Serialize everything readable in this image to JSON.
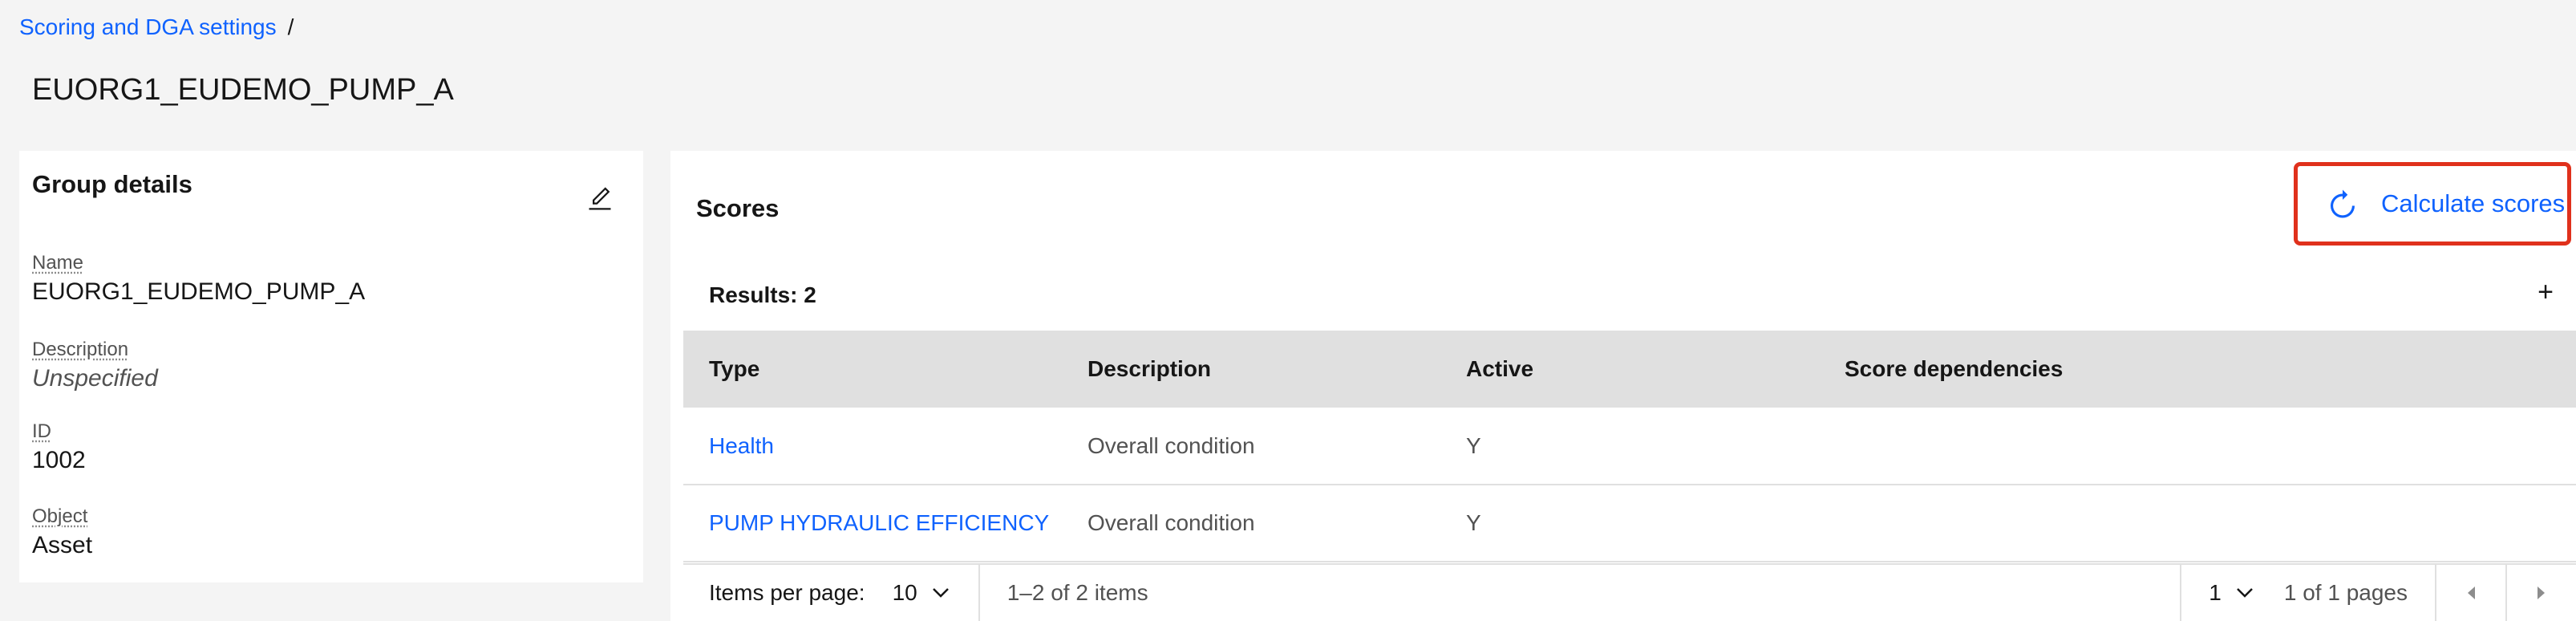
{
  "breadcrumb": {
    "link": "Scoring and DGA settings",
    "separator": "/"
  },
  "page_title": "EUORG1_EUDEMO_PUMP_A",
  "details": {
    "heading": "Group details",
    "edit_icon": "edit-icon",
    "fields": [
      {
        "label": "Name",
        "value": "EUORG1_EUDEMO_PUMP_A"
      },
      {
        "label": "Description",
        "value": "Unspecified"
      },
      {
        "label": "ID",
        "value": "1002"
      },
      {
        "label": "Object",
        "value": "Asset"
      }
    ]
  },
  "scores": {
    "title": "Scores",
    "calculate_label": "Calculate scores",
    "calculate_icon": "refresh-icon",
    "results_label": "Results: 2",
    "add_icon": "+",
    "columns": [
      "Type",
      "Description",
      "Active",
      "Score dependencies"
    ],
    "rows": [
      {
        "type": "Health",
        "description": "Overall condition",
        "active": "Y",
        "dependencies": ""
      },
      {
        "type": "PUMP HYDRAULIC EFFICIENCY",
        "description": "Overall condition",
        "active": "Y",
        "dependencies": ""
      }
    ],
    "pagination": {
      "items_per_page_label": "Items per page:",
      "items_per_page": "10",
      "range": "1–2 of 2 items",
      "page": "1",
      "of_pages": "1 of 1 pages"
    }
  },
  "colors": {
    "link": "#0f62fe",
    "highlight": "#e0311c",
    "header_bg": "#e0e0e0"
  }
}
